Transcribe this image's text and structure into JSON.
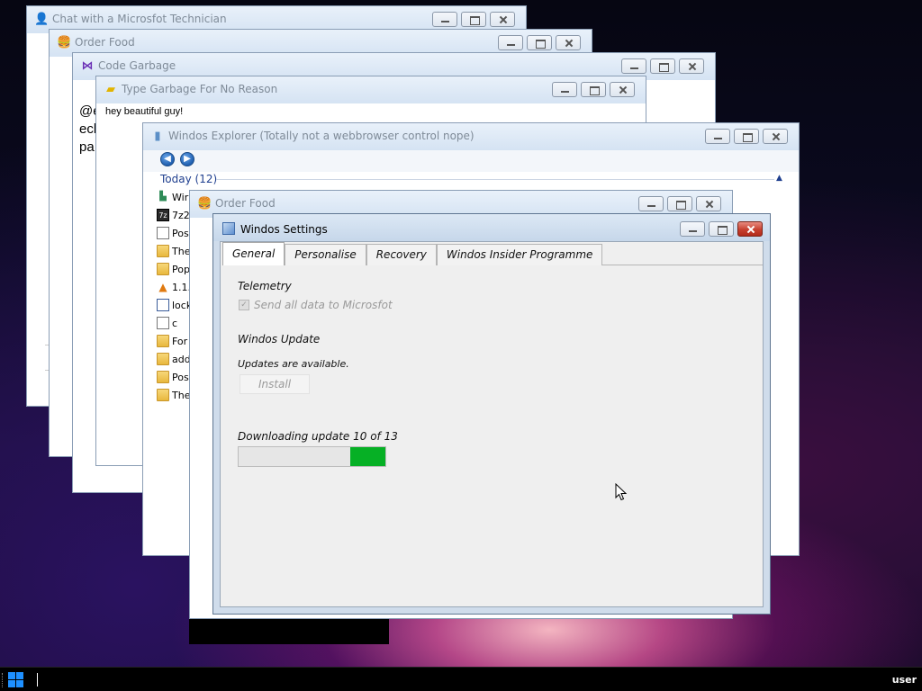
{
  "windows": {
    "chat": {
      "title": "Chat with a Microsfot Technician",
      "lines": [
        "@e",
        "ecl",
        "pa"
      ]
    },
    "order_food_back": {
      "title": "Order Food"
    },
    "code_garbage": {
      "title": "Code Garbage"
    },
    "type_garbage": {
      "title": "Type Garbage For No Reason",
      "text": "hey beautiful guy!"
    },
    "explorer": {
      "title": "Windos Explorer (Totally not a webbrowser control nope)",
      "group_header": "Today (12)",
      "files": [
        {
          "name": "Wir",
          "icon": "program-icon"
        },
        {
          "name": "7z2",
          "icon": "7zip-icon"
        },
        {
          "name": "Pos",
          "icon": "document-icon"
        },
        {
          "name": "The",
          "icon": "folder-icon"
        },
        {
          "name": "Pop",
          "icon": "folder-icon"
        },
        {
          "name": "1.1.",
          "icon": "vlc-icon"
        },
        {
          "name": "lock",
          "icon": "lock-file-icon"
        },
        {
          "name": "c",
          "icon": "text-file-icon"
        },
        {
          "name": "For",
          "icon": "folder-icon"
        },
        {
          "name": "add",
          "icon": "folder-icon"
        },
        {
          "name": "Pos",
          "icon": "folder-icon"
        },
        {
          "name": "The",
          "icon": "folder-icon"
        }
      ]
    },
    "order_food_front": {
      "title": "Order Food"
    }
  },
  "settings": {
    "title": "Windos Settings",
    "tabs": [
      "General",
      "Personalise",
      "Recovery",
      "Windos Insider Programme"
    ],
    "active_tab": "General",
    "telemetry_heading": "Telemetry",
    "telemetry_checkbox_label": "Send all data to Microsfot",
    "telemetry_checked": true,
    "update_heading": "Windos Update",
    "update_status": "Updates are available.",
    "install_label": "Install",
    "download_label": "Downloading update 10 of 13",
    "download_progress": 0.24,
    "progress_color": "#06b025"
  },
  "taskbar": {
    "user_label": "user"
  }
}
